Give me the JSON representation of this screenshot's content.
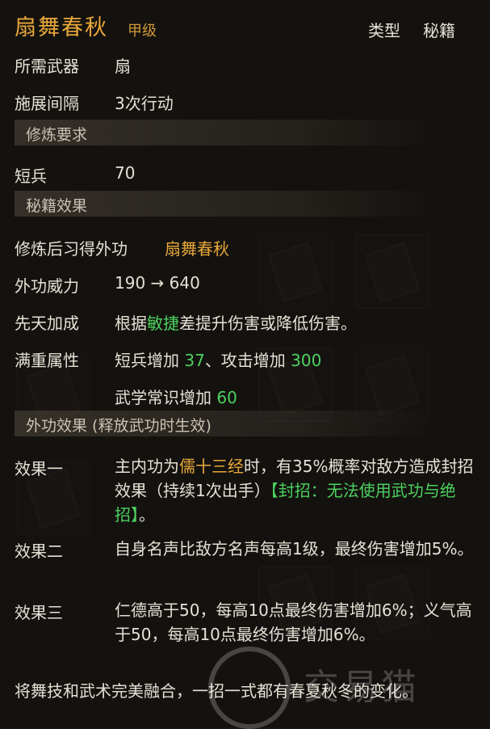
{
  "header": {
    "skill_name": "扇舞春秋",
    "grade": "甲级",
    "type_label": "类型",
    "type_value": "秘籍"
  },
  "info": {
    "weapon_label": "所需武器",
    "weapon_value": "扇",
    "interval_label": "施展间隔",
    "interval_value": "3次行动"
  },
  "requirements": {
    "section_title": "修炼要求",
    "short_weapon_label": "短兵",
    "short_weapon_value": "70"
  },
  "effects": {
    "section_title": "秘籍效果",
    "learn_label": "修炼后习得外功",
    "learn_value": "扇舞春秋",
    "power_label": "外功威力",
    "power_value": "190 → 640",
    "innate_label": "先天加成",
    "innate_prefix": "根据",
    "innate_highlight": "敏捷",
    "innate_suffix": "差提升伤害或降低伤害。",
    "full_label": "满重属性",
    "full_a_text": "短兵增加 ",
    "full_a_value": "37",
    "full_sep": "、攻击增加 ",
    "full_b_value": "300",
    "full_c_text": "武学常识增加 ",
    "full_c_value": "60"
  },
  "skill_effects": {
    "section_title": "外功效果 (释放武功时生效)",
    "e1_label": "效果一",
    "e1_prefix": "主内功为",
    "e1_highlight": "儒十三经",
    "e1_mid": "时，有35%概率对敌方造成封招效果（持续1次出手）",
    "e1_bracket": "【封招：无法使用武功与绝招】",
    "e1_end": "。",
    "e2_label": "效果二",
    "e2_text": "自身名声比敌方名声每高1级，最终伤害增加5%。",
    "e3_label": "效果三",
    "e3_text": "仁德高于50，每高10点最终伤害增加6%；义气高于50，每高10点最终伤害增加6%。"
  },
  "description": "将舞技和武术完美融合，一招一式都有春夏秋冬的变化。",
  "watermark": "交易猫",
  "colors": {
    "gold": "#e8a83a",
    "green": "#4cd15f"
  }
}
